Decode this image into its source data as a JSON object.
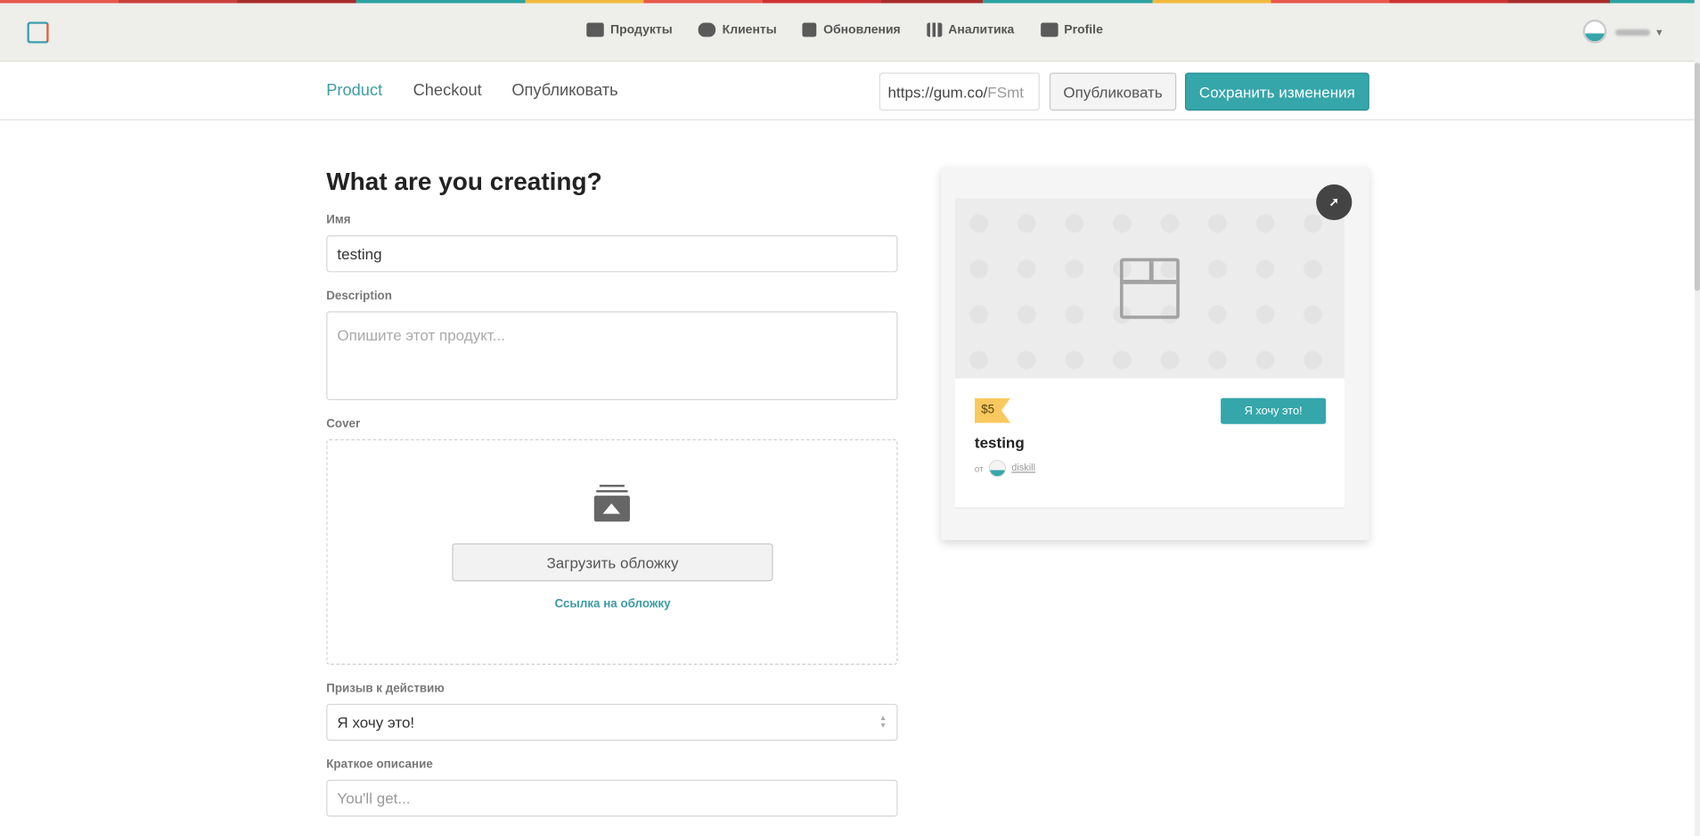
{
  "header": {
    "nav": [
      {
        "label": "Продукты",
        "icon": "archive-icon"
      },
      {
        "label": "Клиенты",
        "icon": "users-icon"
      },
      {
        "label": "Обновления",
        "icon": "document-icon"
      },
      {
        "label": "Аналитика",
        "icon": "bar-chart-icon"
      },
      {
        "label": "Profile",
        "icon": "store-icon"
      }
    ]
  },
  "subnav": {
    "tabs": [
      "Product",
      "Checkout",
      "Опубликовать"
    ],
    "url_value": "https://gum.co/",
    "url_slug": "FSmt",
    "publish_label": "Опубликовать",
    "save_label": "Сохранить изменения"
  },
  "form": {
    "heading": "What are you creating?",
    "name_label": "Имя",
    "name_value": "testing",
    "description_label": "Description",
    "description_placeholder": "Опишите этот продукт...",
    "cover_label": "Cover",
    "upload_label": "Загрузить обложку",
    "cover_link": "Ссылка на обложку",
    "cta_label": "Призыв к действию",
    "cta_value": "Я хочу это!",
    "summary_label": "Краткое описание",
    "summary_placeholder": "You'll get..."
  },
  "preview": {
    "price": "$5",
    "buy_label": "Я хочу это!",
    "title": "testing",
    "by": "от",
    "author": "diskill"
  },
  "colors": {
    "accent": "#35a6aa",
    "price_tag": "#f9c85e"
  }
}
